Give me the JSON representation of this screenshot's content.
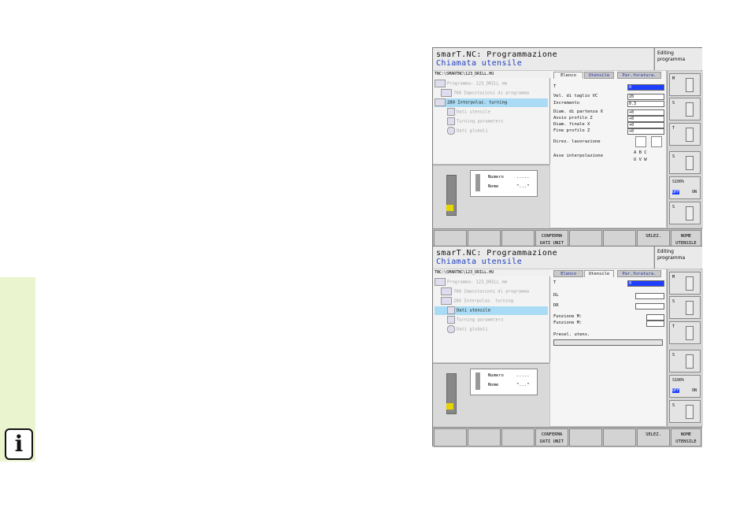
{
  "sidebar": {
    "icon": "info-icon",
    "icon_text": "i"
  },
  "screen1": {
    "title": "smarT.NC: Programmazione",
    "subtitle": "Chiamata utensile",
    "mode": "Editing programma",
    "path": "TNC:\\SMARTNC\\123_DRILL.HU",
    "tree": [
      {
        "label": "Programma: 123_DRILL mm",
        "state": "dim"
      },
      {
        "label": "700 Impostazioni di programma",
        "state": "dim"
      },
      {
        "label": "280 Interpolaz. turning",
        "state": "sel"
      },
      {
        "label": "Dati utensile",
        "state": "dim"
      },
      {
        "label": "Turning parameters",
        "state": "dim"
      },
      {
        "label": "Dati globali",
        "state": "dim"
      }
    ],
    "card": {
      "numero_label": "Numero",
      "numero_value": ".....",
      "nome_label": "Nome",
      "nome_value": "\"...\""
    },
    "tabs": [
      "Elenco",
      "Utensile",
      "Par.foratura."
    ],
    "fields": [
      {
        "label": "T",
        "value": "0"
      },
      {
        "label": "Vel. di taglio VC",
        "value": "20"
      },
      {
        "label": "Incremento",
        "value": "0.3"
      },
      {
        "label": "Diam. di partenza X",
        "value": "+0"
      },
      {
        "label": "Avvio profilo Z",
        "value": "+0"
      },
      {
        "label": "Diam. finale X",
        "value": "+0"
      },
      {
        "label": "Fine profilo Z",
        "value": "+0"
      }
    ],
    "direz_label": "Direz. lavorazione",
    "asse_label": "Asse interpolazione",
    "asse_options": "A  B  C",
    "asse_options2": "U  V  W"
  },
  "screen2": {
    "title": "smarT.NC: Programmazione",
    "subtitle": "Chiamata utensile",
    "mode": "Editing programma",
    "path": "TNC:\\SMARTNC\\123_DRILL.HU",
    "tree": [
      {
        "label": "Programma: 123_DRILL mm",
        "state": "dim"
      },
      {
        "label": "700 Impostazioni di programma",
        "state": "dim"
      },
      {
        "label": "280 Interpolaz. turning",
        "state": "dim"
      },
      {
        "label": "Dati utensile",
        "state": "sel"
      },
      {
        "label": "Turning parameters",
        "state": "dim"
      },
      {
        "label": "Dati globali",
        "state": "dim"
      }
    ],
    "card": {
      "numero_label": "Numero",
      "numero_value": ".....",
      "nome_label": "Nome",
      "nome_value": "\"...\""
    },
    "tabs": [
      "Elenco",
      "Utensile",
      "Par.foratura."
    ],
    "t_label": "T",
    "t_value": "0",
    "dl_label": "DL",
    "dr_label": "DR",
    "funzione1": "Funzione M:",
    "funzione2": "Funzione M:",
    "presel": "Presel. utens."
  },
  "right_panel": [
    {
      "label": "M"
    },
    {
      "label": "S"
    },
    {
      "label": "T"
    },
    {
      "label": "S"
    },
    {
      "label": "S100%",
      "sub1": "OFF",
      "sub2": "ON"
    },
    {
      "label": "S"
    }
  ],
  "softkeys": [
    "",
    "",
    "",
    "CONFERMA DATI UNIT",
    "",
    "",
    "SELEZ.",
    "NOME UTENSILE"
  ]
}
